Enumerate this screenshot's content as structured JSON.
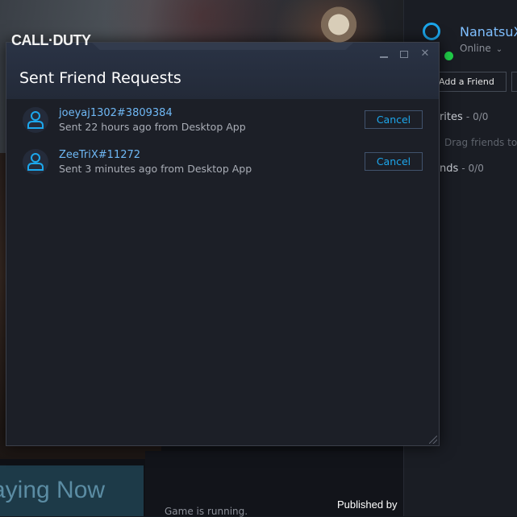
{
  "background": {
    "game_logo": "CALL·DUTY",
    "playing_now": "aying Now",
    "game_running": "Game is running.",
    "published_by": "Published by"
  },
  "friends_panel": {
    "username": "NanatsuX",
    "status": "Online",
    "add_friend_label": "Add a Friend",
    "favorites_label": "orites",
    "favorites_count": "- 0/0",
    "drag_hint": "Drag friends to",
    "friends_label": "ends",
    "friends_count": "- 0/0"
  },
  "modal": {
    "title": "Sent Friend Requests",
    "requests": [
      {
        "name": "joeyaj1302#3809384",
        "meta": "Sent 22 hours ago from Desktop App",
        "action": "Cancel"
      },
      {
        "name": "ZeeTriX#11272",
        "meta": "Sent 3 minutes ago from Desktop App",
        "action": "Cancel"
      }
    ]
  },
  "colors": {
    "accent": "#1ca7ec",
    "name_link": "#6fb8f5",
    "online": "#21d14a"
  },
  "icons": [
    "minimize-icon",
    "maximize-icon",
    "close-icon",
    "user-avatar-icon",
    "chevron-down-icon",
    "resize-grip-icon"
  ]
}
